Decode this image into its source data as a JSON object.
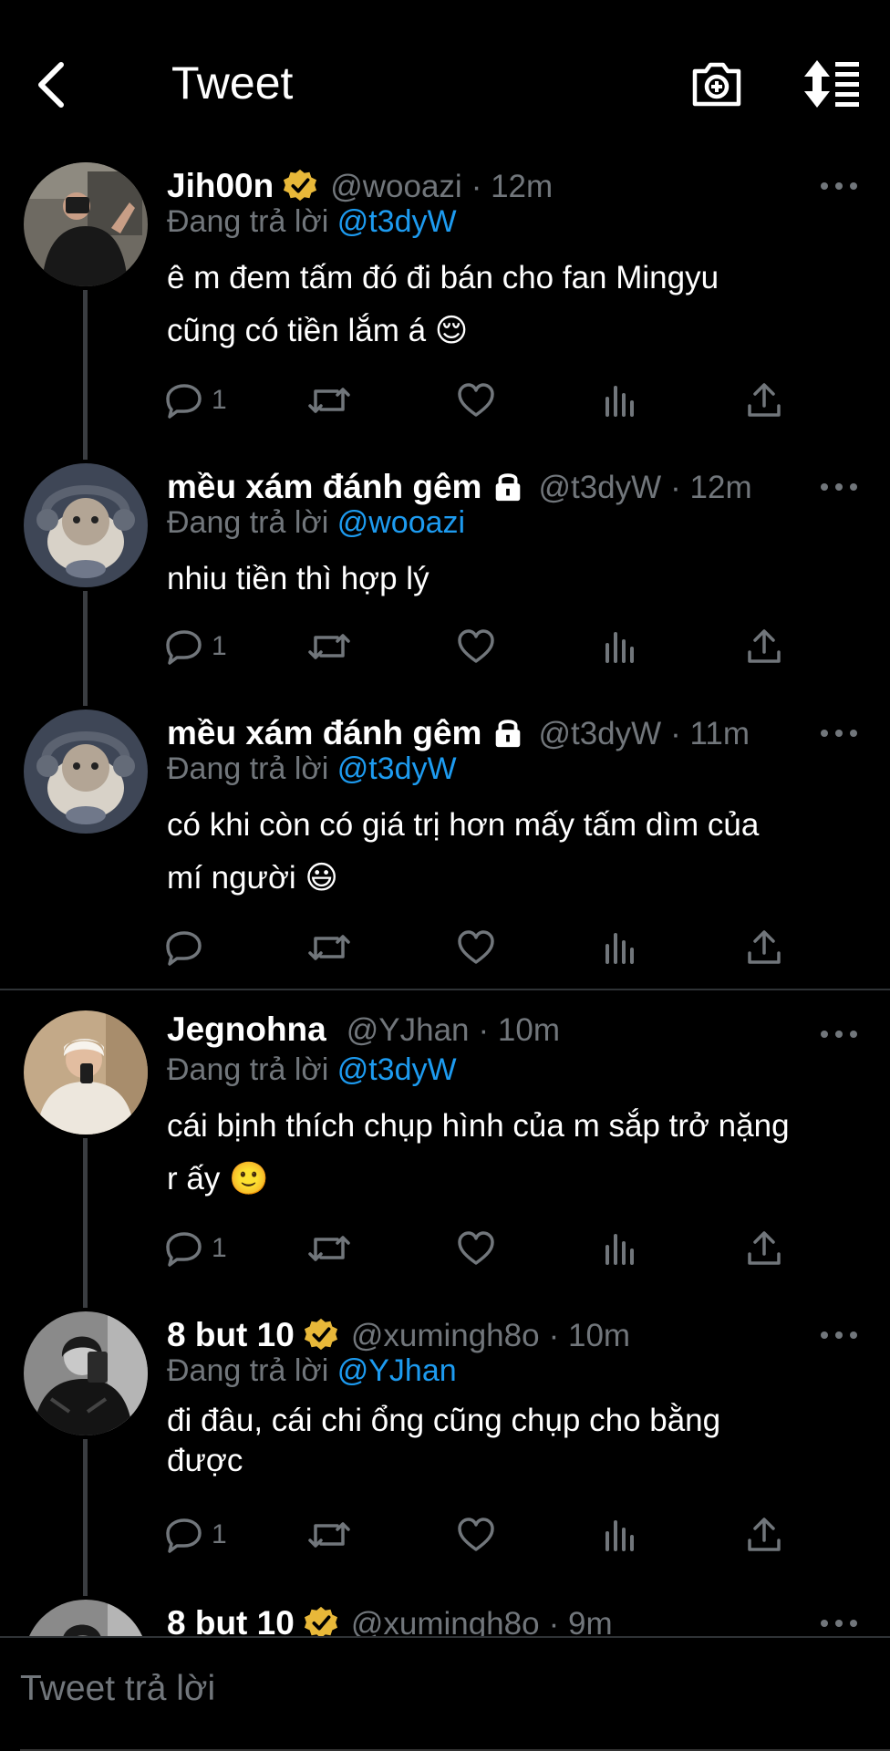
{
  "header": {
    "title": "Tweet",
    "icons": [
      "back-arrow-icon",
      "camera-plus-icon",
      "sort-icon"
    ]
  },
  "colors": {
    "background": "#000000",
    "text": "#ffffff",
    "secondary": "#71767b",
    "mention": "#1d9bf0",
    "verified": "#e8b839"
  },
  "tweets": [
    {
      "name": "Jih00n",
      "verified": true,
      "locked": false,
      "handle": "@wooazi",
      "time": "· 12m",
      "reply_prefix": "Đang trả lời",
      "reply_to": "@t3dyW",
      "text_lines": [
        "ê m đem tấm đó đi bán cho fan Mingyu",
        "cũng có tiền lắm á 😌"
      ],
      "reply_count": "1"
    },
    {
      "name": "mều xám đánh gêm",
      "verified": false,
      "locked": true,
      "handle": "@t3dyW",
      "time": "· 12m",
      "reply_prefix": "Đang trả lời",
      "reply_to": "@wooazi",
      "text_lines": [
        "nhiu tiền thì hợp lý"
      ],
      "reply_count": "1"
    },
    {
      "name": "mều xám đánh gêm",
      "verified": false,
      "locked": true,
      "handle": "@t3dyW",
      "time": "· 11m",
      "reply_prefix": "Đang trả lời",
      "reply_to": "@t3dyW",
      "text_lines": [
        "có khi còn có giá trị hơn mấy tấm dìm của",
        "mí người 😃"
      ],
      "reply_count": ""
    },
    {
      "name": "Jegnohna",
      "verified": false,
      "locked": false,
      "handle": "@YJhan",
      "time": "· 10m",
      "reply_prefix": "Đang trả lời",
      "reply_to": "@t3dyW",
      "text_lines": [
        "cái bịnh thích chụp hình của m sắp trở nặng",
        "r ấy 🙂"
      ],
      "reply_count": "1"
    },
    {
      "name": "8 but 10",
      "verified": true,
      "locked": false,
      "handle": "@xumingh8o",
      "time": "· 10m",
      "reply_prefix": "Đang trả lời",
      "reply_to": "@YJhan",
      "text_lines": [
        "đi đâu, cái chi ổng cũng chụp cho bằng",
        "được"
      ],
      "reply_count": "1"
    },
    {
      "name": "8 but 10",
      "verified": true,
      "locked": false,
      "handle": "@xumingh8o",
      "time": "· 9m",
      "reply_prefix": "",
      "reply_to": "",
      "text_lines": [],
      "reply_count": ""
    }
  ],
  "compose": {
    "placeholder": "Tweet trả lời"
  }
}
